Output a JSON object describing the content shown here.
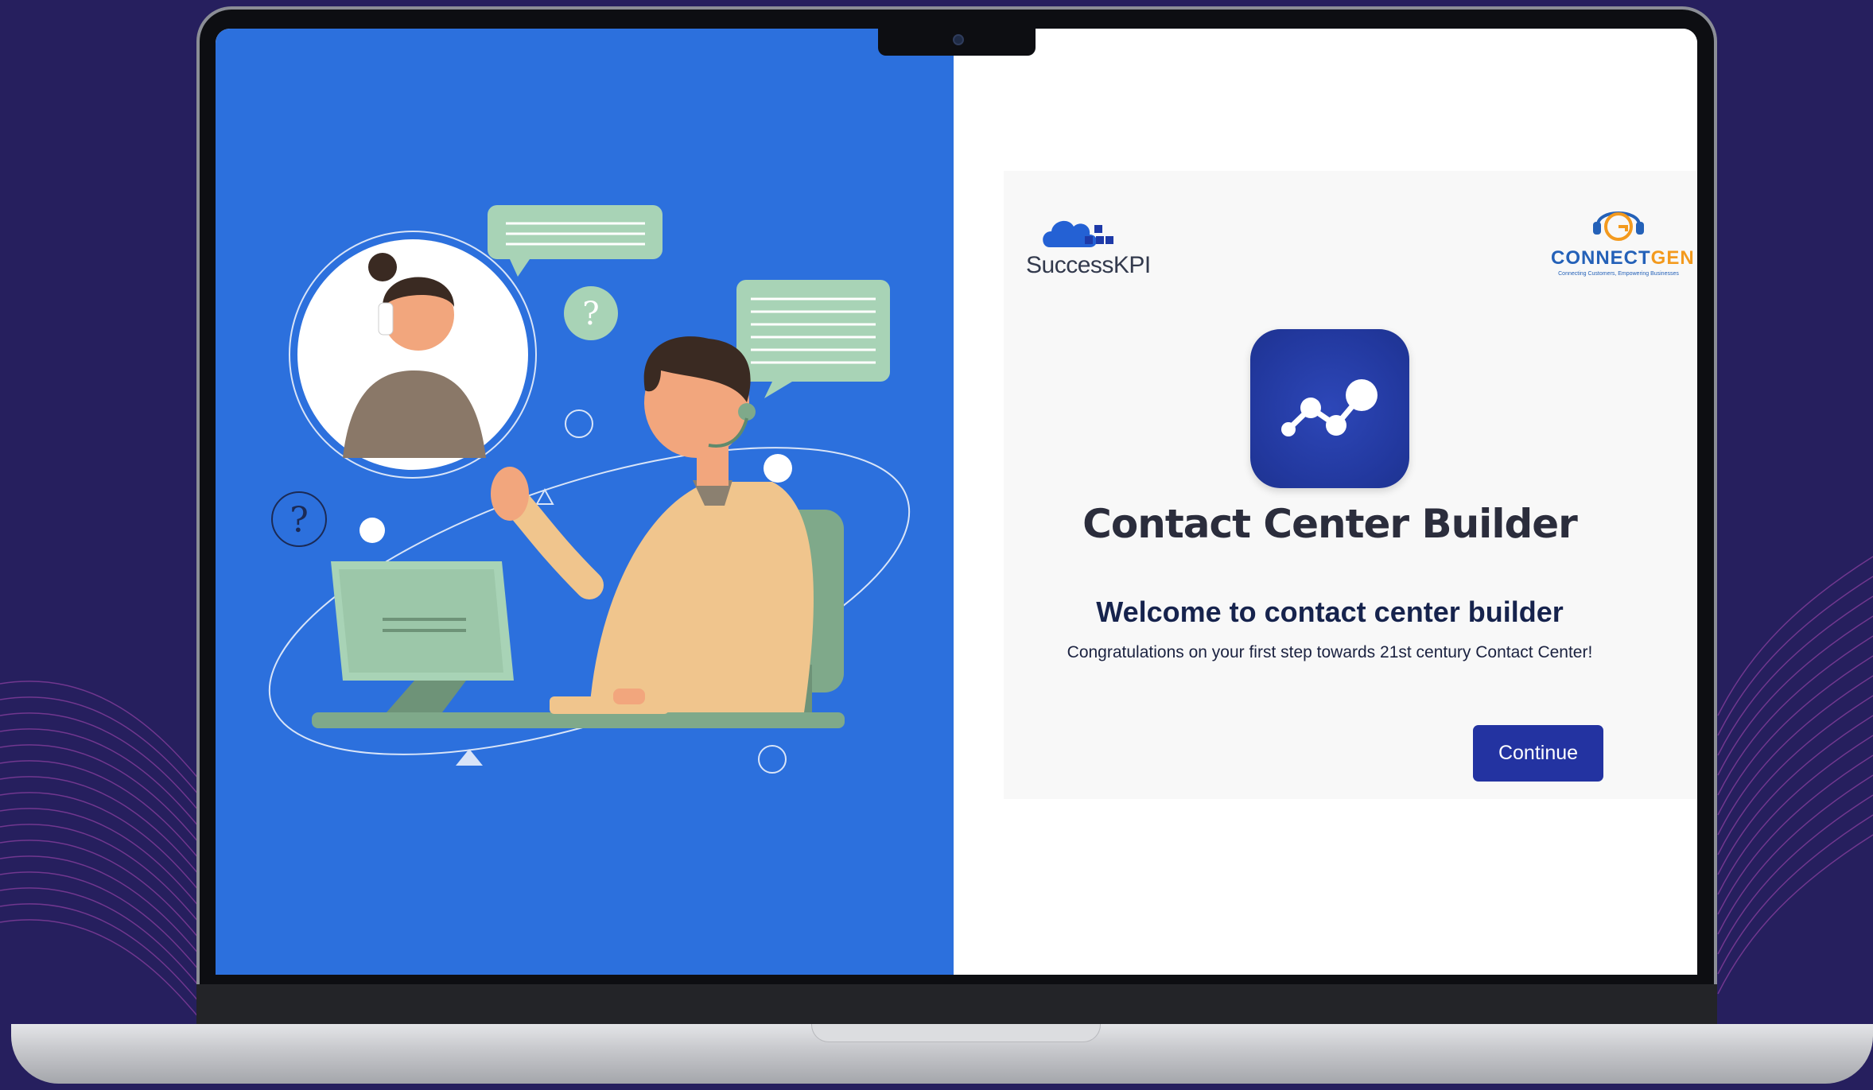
{
  "left_logo": {
    "name": "SuccessKPI"
  },
  "right_logo": {
    "name_part1": "CONNECT",
    "name_part2": "GEN",
    "tagline": "Connecting Customers, Empowering Businesses"
  },
  "app": {
    "title": "Contact Center Builder"
  },
  "welcome": {
    "heading": "Welcome to contact center builder",
    "subtitle": "Congratulations on your first step towards 21st century Contact Center!"
  },
  "actions": {
    "continue_label": "Continue"
  },
  "colors": {
    "left_panel": "#2c70dd",
    "primary_button": "#2333a1",
    "app_icon": "#22389e",
    "background": "#261f5e",
    "wave_lines": "#8a3fa0"
  }
}
